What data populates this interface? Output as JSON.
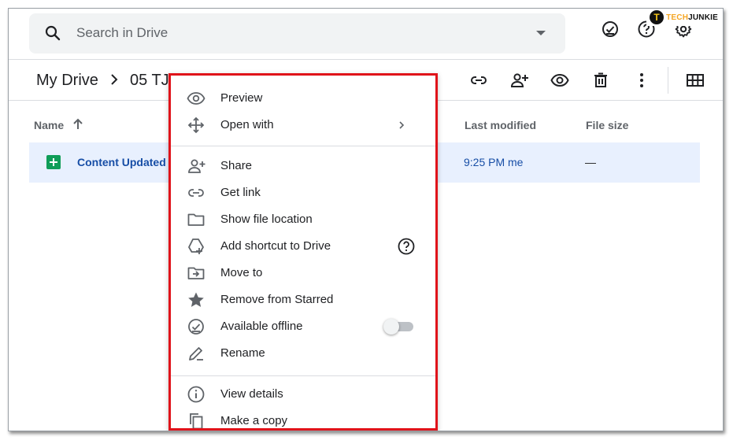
{
  "search": {
    "placeholder": "Search in Drive"
  },
  "logo": {
    "part_a": "TECH",
    "part_b": "JUNKIE",
    "badge": "T"
  },
  "breadcrumb": {
    "root": "My Drive",
    "current": "05 TJ"
  },
  "table": {
    "headers": {
      "name": "Name",
      "last_modified": "Last modified",
      "file_size": "File size"
    },
    "rows": [
      {
        "name": "Content Updated",
        "modified_time": "9:25 PM",
        "modified_by": "me",
        "size": "—"
      }
    ]
  },
  "menu": {
    "items": [
      {
        "label": "Preview",
        "icon": "eye-icon"
      },
      {
        "label": "Open with",
        "icon": "move-arrows-icon"
      },
      {
        "label": "Share",
        "icon": "person-add-icon"
      },
      {
        "label": "Get link",
        "icon": "link-icon"
      },
      {
        "label": "Show file location",
        "icon": "folder-icon"
      },
      {
        "label": "Add shortcut to Drive",
        "icon": "drive-shortcut-icon"
      },
      {
        "label": "Move to",
        "icon": "move-to-folder-icon"
      },
      {
        "label": "Remove from Starred",
        "icon": "star-icon"
      },
      {
        "label": "Available offline",
        "icon": "offline-check-icon",
        "toggle": false
      },
      {
        "label": "Rename",
        "icon": "pencil-icon"
      },
      {
        "label": "View details",
        "icon": "info-icon"
      },
      {
        "label": "Make a copy",
        "icon": "copy-icon"
      }
    ]
  },
  "colors": {
    "highlight_border": "#e0131a",
    "selected_row": "#e8f0fe",
    "sheets_green": "#0f9d58",
    "link_blue": "#174ea6"
  }
}
